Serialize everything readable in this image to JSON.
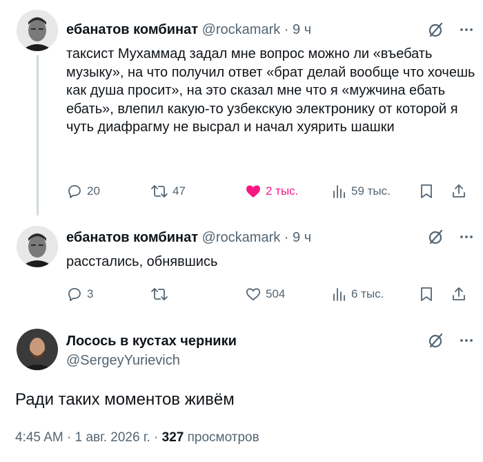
{
  "tweets": [
    {
      "display_name": "ебанатов комбинат",
      "handle": "@rockamark",
      "separator": "·",
      "time": "9 ч",
      "text": "таксист Мухаммад задал мне вопрос можно ли «въебать музыку», на что получил ответ «брат делай вообще что хочешь как душа просит», на это сказал мне что я «мужчина ебать ебать», влепил какую-то узбекскую электронику от которой я чуть диафрагму не высрал и начал хуярить шашки",
      "replies": "20",
      "reposts": "47",
      "likes": "2 тыс.",
      "views": "59 тыс.",
      "liked": true
    },
    {
      "display_name": "ебанатов комбинат",
      "handle": "@rockamark",
      "separator": "·",
      "time": "9 ч",
      "text": "расстались, обнявшись",
      "replies": "3",
      "reposts": "",
      "likes": "504",
      "views": "6 тыс.",
      "liked": false
    }
  ],
  "main_tweet": {
    "display_name": "Лосось в кустах черники",
    "handle": "@SergeyYurievich",
    "text": "Ради таких моментов живём",
    "time": "4:45 AM",
    "separator": "·",
    "date": "1 авг. 2026 г.",
    "separator2": "·",
    "views_count": "327",
    "views_label": "просмотров"
  },
  "icons": [
    "grok-icon",
    "more-icon",
    "reply-icon",
    "repost-icon",
    "like-icon",
    "views-icon",
    "bookmark-icon",
    "share-icon"
  ],
  "colors": {
    "text": "#0f1419",
    "secondary": "#536471",
    "like": "#f91880",
    "thread_line": "#cfd9de"
  }
}
